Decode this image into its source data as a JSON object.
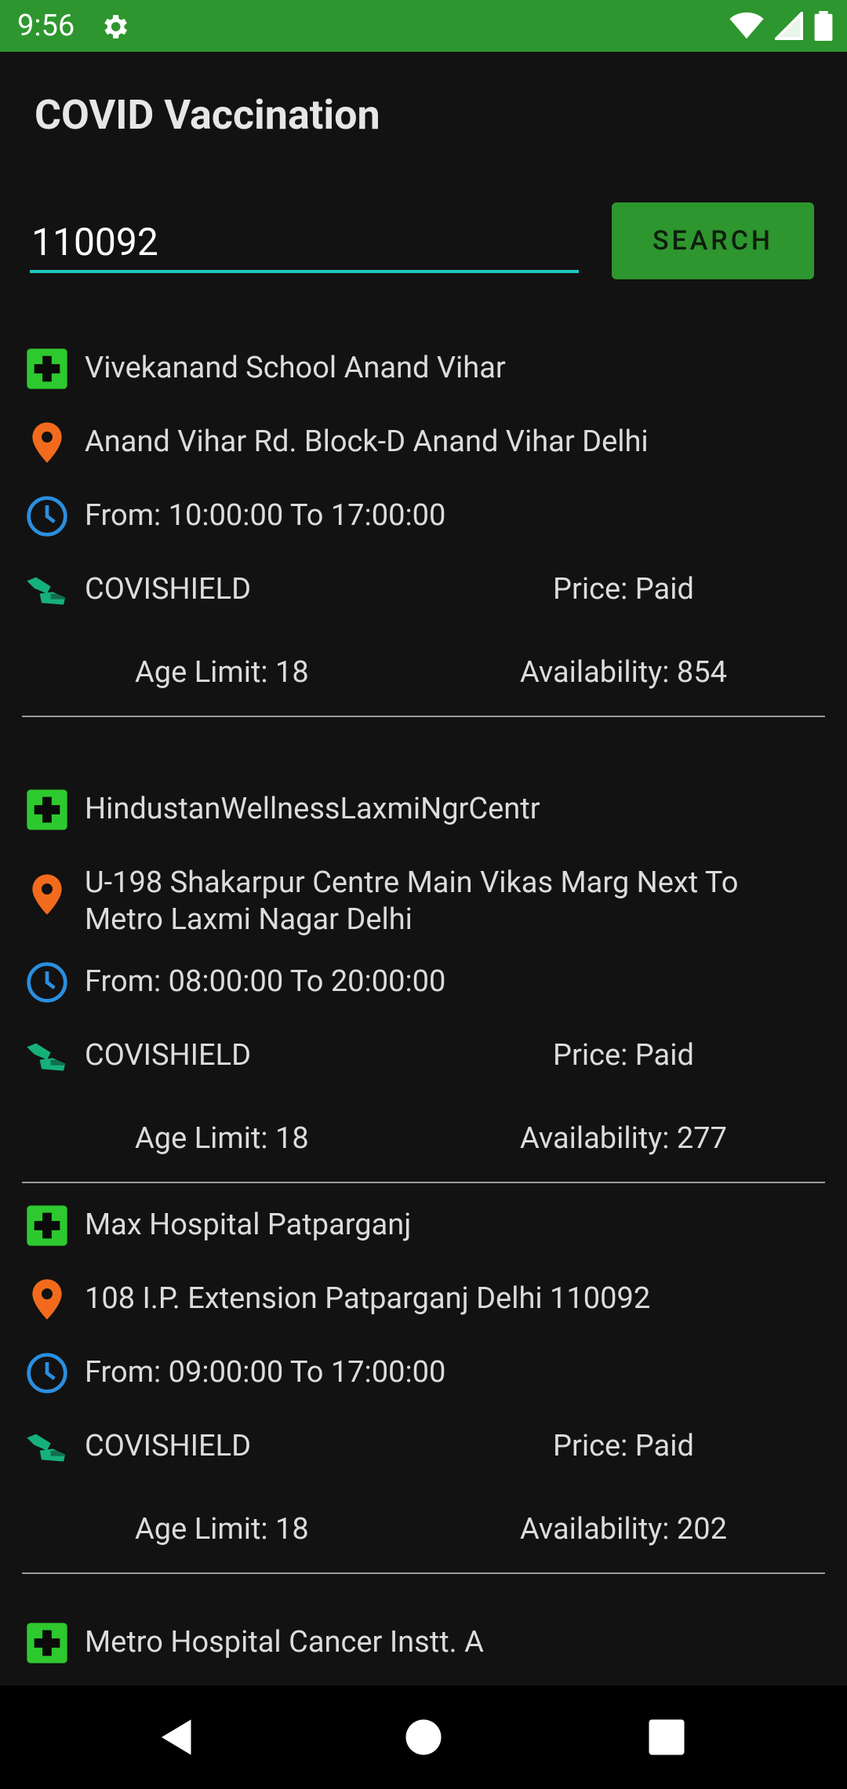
{
  "status_bar": {
    "time": "9:56",
    "icons": [
      "gear-icon",
      "wifi-icon",
      "signal-icon",
      "battery-icon"
    ],
    "color": "#2e962e"
  },
  "app": {
    "title": "COVID Vaccination"
  },
  "search": {
    "value": "110092",
    "button_label": "SEARCH",
    "accent": "#1fc7c0"
  },
  "centers": [
    {
      "name": "Vivekanand School Anand Vihar",
      "address": "Anand Vihar Rd. Block-D Anand Vihar Delhi",
      "time": "From: 10:00:00 To 17:00:00",
      "vaccine": "COVISHIELD",
      "price": "Price: Paid",
      "age": "Age Limit: 18",
      "availability": "Availability: 854"
    },
    {
      "name": "HindustanWellnessLaxmiNgrCentr",
      "address": "U-198 Shakarpur Centre Main Vikas Marg Next To Metro Laxmi Nagar Delhi",
      "time": "From: 08:00:00 To 20:00:00",
      "vaccine": "COVISHIELD",
      "price": "Price: Paid",
      "age": "Age Limit: 18",
      "availability": "Availability: 277"
    },
    {
      "name": "Max Hospital Patparganj",
      "address": "108 I.P. Extension Patparganj Delhi 110092",
      "time": "From: 09:00:00 To 17:00:00",
      "vaccine": "COVISHIELD",
      "price": "Price: Paid",
      "age": "Age Limit: 18",
      "availability": "Availability: 202"
    },
    {
      "name": "Metro Hospital Cancer Instt. A"
    }
  ],
  "icon_colors": {
    "hospital": "#2ec92e",
    "location": "#f26b1d",
    "clock": "#2b8fe0",
    "vaccine": "#16b07a"
  },
  "nav": [
    "back-icon",
    "home-icon",
    "recents-icon"
  ]
}
